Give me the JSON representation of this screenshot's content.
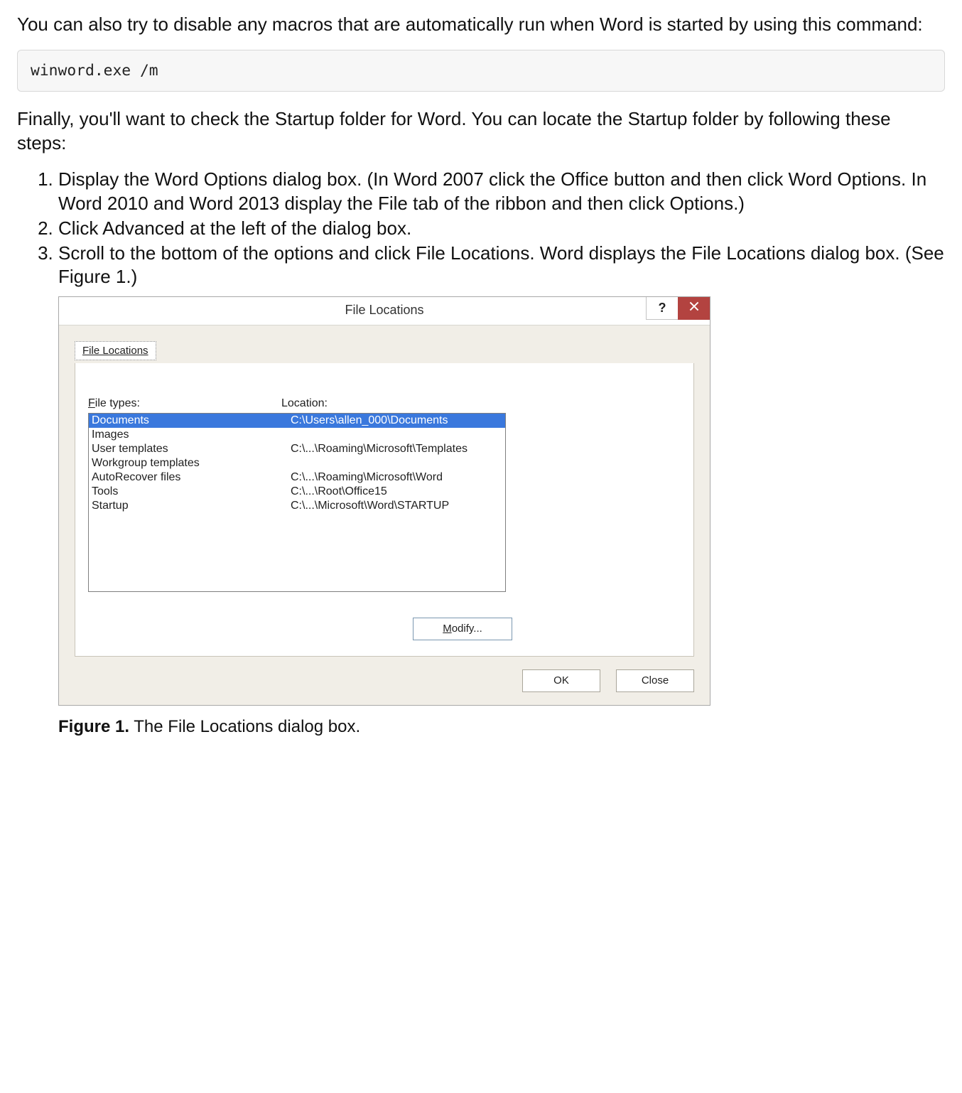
{
  "article": {
    "para1": "You can also try to disable any macros that are automatically run when Word is started by using this command:",
    "code1": "winword.exe /m",
    "para2": "Finally, you'll want to check the Startup folder for Word. You can locate the Startup folder by following these steps:",
    "steps": [
      "Display the Word Options dialog box. (In Word 2007 click the Office button and then click Word Options. In Word 2010 and Word 2013 display the File tab of the ribbon and then click Options.)",
      "Click Advanced at the left of the dialog box.",
      "Scroll to the bottom of the options and click File Locations. Word displays the File Locations dialog box. (See Figure 1.)"
    ],
    "figure_label": "Figure 1.",
    "figure_caption": " The File Locations dialog box."
  },
  "dialog": {
    "title": "File Locations",
    "help_label": "?",
    "tab_label": "File Locations",
    "header_left_underline": "F",
    "header_left_rest": "ile types:",
    "header_right": "Location:",
    "rows": [
      {
        "type": "Documents",
        "location": "C:\\Users\\allen_000\\Documents",
        "selected": true
      },
      {
        "type": "Images",
        "location": "",
        "selected": false
      },
      {
        "type": "User templates",
        "location": "C:\\...\\Roaming\\Microsoft\\Templates",
        "selected": false
      },
      {
        "type": "Workgroup templates",
        "location": "",
        "selected": false
      },
      {
        "type": "AutoRecover files",
        "location": "C:\\...\\Roaming\\Microsoft\\Word",
        "selected": false
      },
      {
        "type": "Tools",
        "location": "C:\\...\\Root\\Office15",
        "selected": false
      },
      {
        "type": "Startup",
        "location": "C:\\...\\Microsoft\\Word\\STARTUP",
        "selected": false
      }
    ],
    "modify_underline": "M",
    "modify_rest": "odify...",
    "ok_label": "OK",
    "close_label": "Close"
  }
}
